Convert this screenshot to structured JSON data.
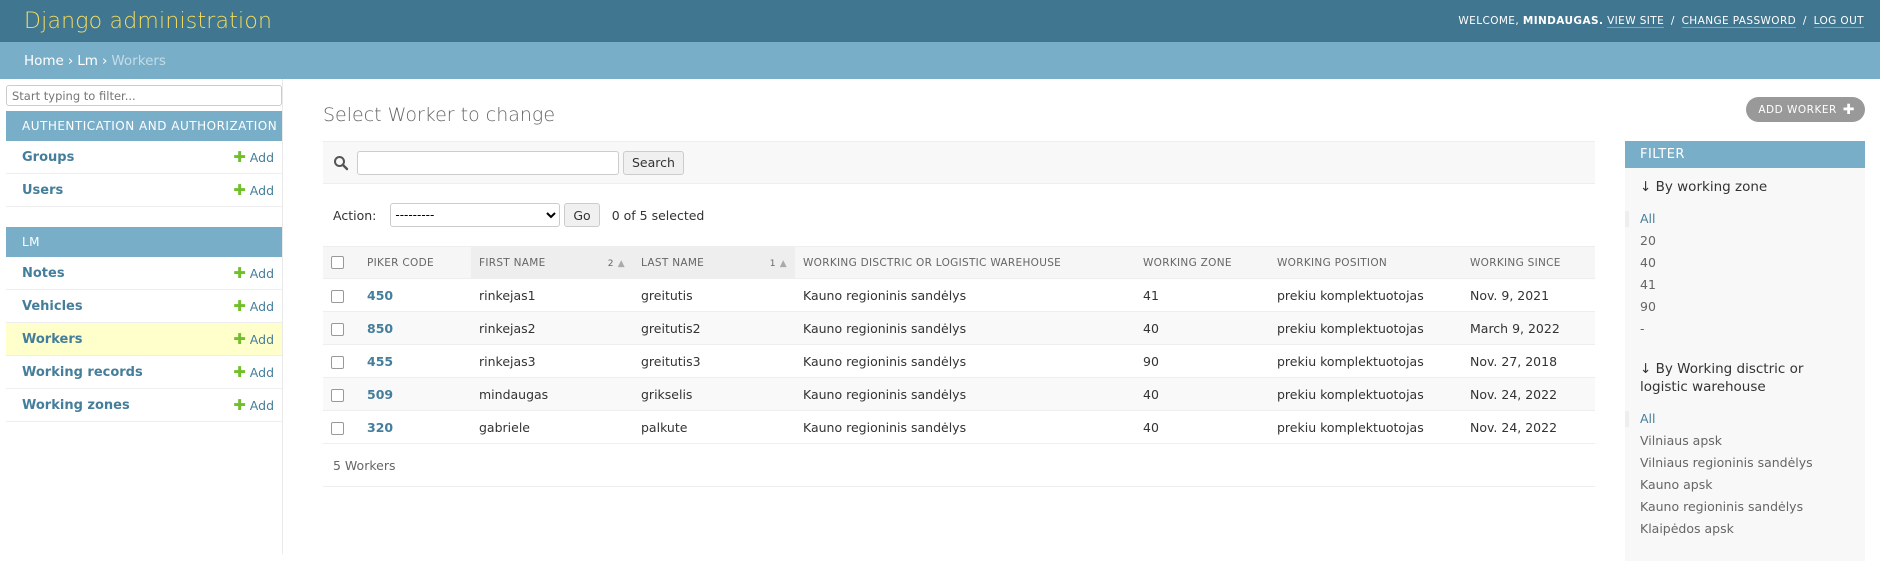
{
  "header": {
    "branding": "Django administration",
    "welcome": "WELCOME,",
    "username": "MINDAUGAS.",
    "view_site": "VIEW SITE",
    "change_password": "CHANGE PASSWORD",
    "log_out": "LOG OUT",
    "separator": "/"
  },
  "breadcrumbs": {
    "home": "Home",
    "app": "Lm",
    "current": "Workers",
    "separator": "›"
  },
  "sidebar": {
    "filter_placeholder": "Start typing to filter...",
    "add_label": "Add",
    "modules": [
      {
        "caption": "Authentication and Authorization",
        "models": [
          {
            "name": "Groups"
          },
          {
            "name": "Users"
          }
        ]
      },
      {
        "caption": "LM",
        "models": [
          {
            "name": "Notes"
          },
          {
            "name": "Vehicles"
          },
          {
            "name": "Workers",
            "current": true
          },
          {
            "name": "Working records"
          },
          {
            "name": "Working zones"
          }
        ]
      }
    ]
  },
  "content": {
    "title": "Select Worker to change",
    "add_button": "ADD WORKER",
    "search_button": "Search",
    "search_value": "",
    "action_label": "Action:",
    "action_selected": "---------",
    "go_button": "Go",
    "action_counter": "0 of 5 selected",
    "paginator": "5 Workers"
  },
  "table": {
    "columns": [
      {
        "label": "Piker code"
      },
      {
        "label": "First name",
        "priority": "2",
        "sorted": true
      },
      {
        "label": "Last name",
        "priority": "1",
        "sorted": true
      },
      {
        "label": "Working disctric or logistic warehouse"
      },
      {
        "label": "Working zone"
      },
      {
        "label": "Working position"
      },
      {
        "label": "Working since"
      }
    ],
    "rows": [
      [
        "450",
        "rinkejas1",
        "greitutis",
        "Kauno regioninis sandėlys",
        "41",
        "prekiu komplektuotojas",
        "Nov. 9, 2021"
      ],
      [
        "850",
        "rinkejas2",
        "greitutis2",
        "Kauno regioninis sandėlys",
        "40",
        "prekiu komplektuotojas",
        "March 9, 2022"
      ],
      [
        "455",
        "rinkejas3",
        "greitutis3",
        "Kauno regioninis sandėlys",
        "90",
        "prekiu komplektuotojas",
        "Nov. 27, 2018"
      ],
      [
        "509",
        "mindaugas",
        "grikselis",
        "Kauno regioninis sandėlys",
        "40",
        "prekiu komplektuotojas",
        "Nov. 24, 2022"
      ],
      [
        "320",
        "gabriele",
        "palkute",
        "Kauno regioninis sandėlys",
        "40",
        "prekiu komplektuotojas",
        "Nov. 24, 2022"
      ]
    ]
  },
  "filter": {
    "title": "Filter",
    "sections": [
      {
        "title": "↓ By working zone",
        "options": [
          "All",
          "20",
          "40",
          "41",
          "90",
          "-"
        ],
        "selected": 0
      },
      {
        "title": "↓ By Working disctric or logistic warehouse",
        "options": [
          "All",
          "Vilniaus apsk",
          "Vilniaus regioninis sandėlys",
          "Kauno apsk",
          "Kauno regioninis sandėlys",
          "Klaipėdos apsk"
        ],
        "selected": 0
      }
    ]
  },
  "colors": {
    "header_bg": "#417690",
    "branding": "#f5dd5d",
    "breadcrumbs_bg": "#79aec8",
    "link": "#447e9b",
    "current_row": "#ffffcc",
    "add_green": "#70bf2b"
  }
}
